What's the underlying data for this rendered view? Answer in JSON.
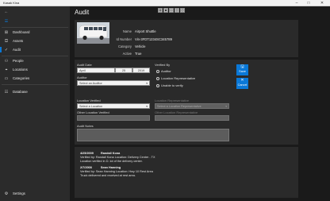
{
  "window": {
    "title": "Kasak Kina"
  },
  "sidebar": {
    "items": [
      {
        "label": "Dashboard",
        "icon": "dashboard-icon"
      },
      {
        "label": "Assets",
        "icon": "assets-icon"
      },
      {
        "label": "Audit",
        "icon": "audit-icon"
      },
      {
        "label": "People",
        "icon": "people-icon"
      },
      {
        "label": "Locations",
        "icon": "locations-icon"
      },
      {
        "label": "Categories",
        "icon": "categories-icon"
      },
      {
        "label": "Database",
        "icon": "database-icon"
      }
    ],
    "settings_label": "Settings"
  },
  "main": {
    "title": "Audit"
  },
  "vehicle": {
    "name_label": "Name",
    "name": "Airport Shuttle",
    "id_label": "Id Number",
    "id": "Vin-3FDT1234SC345789",
    "category_label": "Category",
    "category": "Vehicle",
    "active_label": "Active",
    "active": "True"
  },
  "form": {
    "audit_date_label": "Audit Date",
    "month": "April",
    "day": "25",
    "year": "2019",
    "auditor_label": "Auditor",
    "auditor_placeholder": "Select an Auditor",
    "verified_by_label": "Verified By",
    "radio_options": [
      "Auditor",
      "Location Representative",
      "Unable to verify"
    ],
    "save_label": "Save",
    "cancel_label": "Cancel",
    "location_verified_label": "Location Verified",
    "location_placeholder": "Select a Location",
    "location_rep_label": "Location Representative",
    "location_rep_placeholder": "Select a Location Representative",
    "other_location_label": "Other Location Verified",
    "other_location_rep_label": "Other Location Representative",
    "notes_label": "Audit Notes"
  },
  "history": [
    {
      "date": "4/25/2009",
      "name": "Randall Kona",
      "line1": "Verified by: Randall Kona    Location: Delivery Center - TX",
      "line2": "Location verified in D. lot of the delivery center."
    },
    {
      "date": "2/7/2008",
      "name": "Sean Hanning",
      "line1": "Verified by: Sean Hanning    Location: Hwy 10 Rest Area",
      "line2": "Truck delivered and received at rest area."
    }
  ],
  "colors": {
    "accent": "#0a78d7",
    "background": "#1a1a1a",
    "sidebar": "#2b2b2b",
    "card": "#2a2a2a"
  }
}
